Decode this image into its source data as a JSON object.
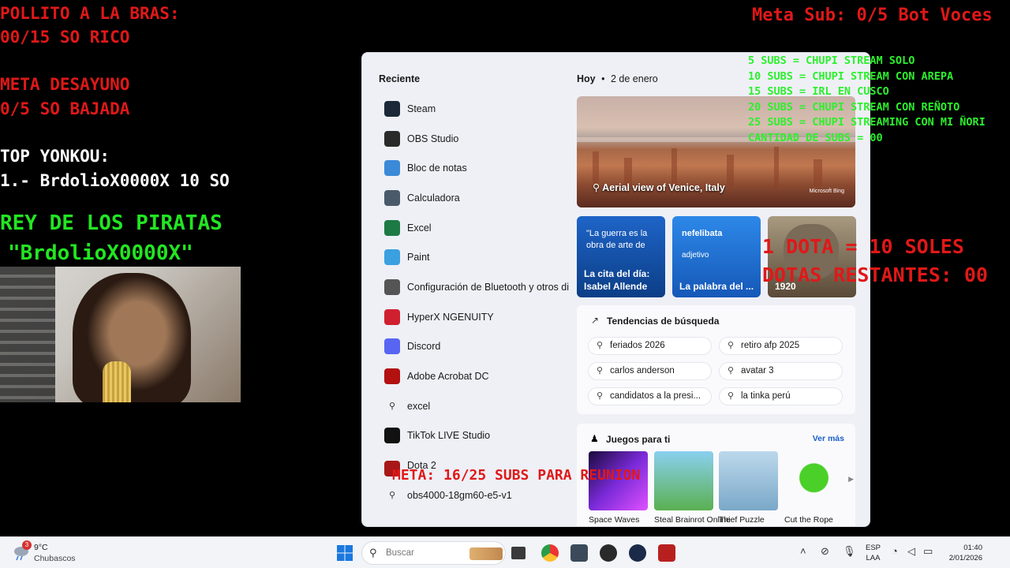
{
  "overlay": {
    "pollito_line1": "POLLITO A LA BRAS:",
    "pollito_line2": "00/15 SO RICO",
    "desayuno_line1": "META DESAYUNO",
    "desayuno_line2": "0/5 SO BAJADA",
    "yonkou_title": "TOP YONKOU:",
    "yonkou_entry": "1.- BrdolioX0000X 10 SO",
    "rey_title": "REY DE LOS PIRATAS",
    "rey_name": "\"BrdolioX0000X\"",
    "meta_sub": "Meta Sub: 0/5 Bot Voces",
    "subs_goals": [
      "5 SUBS = CHUPI STREAM SOLO",
      "10 SUBS = CHUPI STREAM CON AREPA",
      "15 SUBS = IRL EN CUSCO",
      "20 SUBS = CHUPI STREAM CON REÑOTO",
      "25 SUBS = CHUPI STREAMING CON MI ÑORI",
      "CANTIDAD DE SUBS = 00"
    ],
    "dota_line1": "1 DOTA = 10 SOLES",
    "dota_line2": "DOTAS RESTANTES: 00",
    "meta_reunion": "META: 16/25 SUBS PARA REUNION"
  },
  "start_menu": {
    "recent_header": "Reciente",
    "today_header": "Hoy",
    "today_date": "2 de enero",
    "recent": [
      {
        "label": "Steam",
        "icon": "steam-icon"
      },
      {
        "label": "OBS Studio",
        "icon": "obs-icon"
      },
      {
        "label": "Bloc de notas",
        "icon": "notepad-icon"
      },
      {
        "label": "Calculadora",
        "icon": "calculator-icon"
      },
      {
        "label": "Excel",
        "icon": "excel-icon"
      },
      {
        "label": "Paint",
        "icon": "paint-icon"
      },
      {
        "label": "Configuración de Bluetooth y otros di...",
        "icon": "bluetooth-settings-icon"
      },
      {
        "label": "HyperX NGENUITY",
        "icon": "hyperx-icon"
      },
      {
        "label": "Discord",
        "icon": "discord-icon"
      },
      {
        "label": "Adobe Acrobat DC",
        "icon": "acrobat-icon"
      },
      {
        "label": "excel",
        "icon": "search-icon"
      },
      {
        "label": "TikTok LIVE Studio",
        "icon": "tiktok-icon"
      },
      {
        "label": "Dota 2",
        "icon": "dota-icon"
      },
      {
        "label": "obs4000-18gm60-e5-v1",
        "icon": "search-icon"
      }
    ],
    "hero_caption": "Aerial view of Venice, Italy",
    "hero_brand": "Microsoft Bing",
    "cards": [
      {
        "top": "\"La guerra es la obra de arte de",
        "bottom": "La cita del día: Isabel Allende"
      },
      {
        "top": "nefelibata",
        "sub": "adjetivo",
        "bottom": "La palabra del ..."
      },
      {
        "bottom": "1920"
      }
    ],
    "trends_title": "Tendencias de búsqueda",
    "trends": [
      "feriados 2026",
      "retiro afp 2025",
      "carlos anderson",
      "avatar 3",
      "candidatos a la presi...",
      "la tinka perú"
    ],
    "games_title": "Juegos para ti",
    "games_more": "Ver más",
    "games": [
      "Space Waves",
      "Steal Brainrot Online",
      "Thief Puzzle",
      "Cut the Rope"
    ]
  },
  "taskbar": {
    "weather_badge": "3",
    "weather_temp": "9°C",
    "weather_desc": "Chubascos",
    "search_placeholder": "Buscar",
    "lang_line1": "ESP",
    "lang_line2": "LAA",
    "time": "01:40",
    "date": "2/01/2026"
  }
}
